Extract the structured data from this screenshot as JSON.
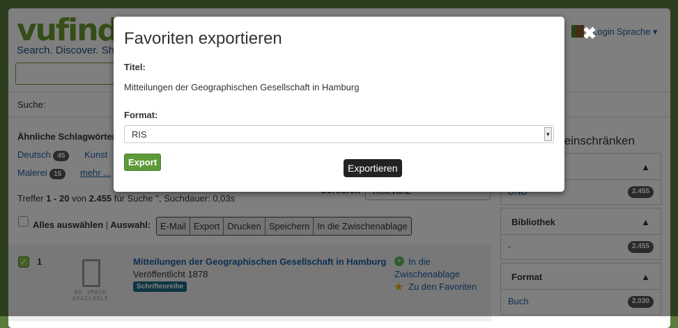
{
  "header": {
    "logo": "vufind",
    "tagline": "Search. Discover. Share.",
    "login": "Login",
    "language": "Sprache"
  },
  "search": {
    "label": "Suche:"
  },
  "similar": {
    "heading": "Ähnliche Schlagwörter",
    "tags": [
      {
        "label": "Deutsch",
        "count": "45"
      },
      {
        "label": "Kunst",
        "count": ""
      },
      {
        "label": "Malerei",
        "count": "15"
      }
    ],
    "more": "mehr ..."
  },
  "results": {
    "prefix": "Treffer ",
    "range": "1 - 20",
    "von": " von ",
    "total": "2.455",
    "suffix": " für Suche '', Suchdauer: 0,03s",
    "sort_label": "Sortieren",
    "sort_value": "Relevanz",
    "select_all": "Alles auswählen",
    "sep": "|",
    "selection": "Auswahl:",
    "actions": [
      "E-Mail",
      "Export",
      "Drucken",
      "Speichern",
      "In die Zwischenablage"
    ]
  },
  "record": {
    "number": "1",
    "no_image": "NO IMAGE AVAILABLE",
    "title": "Mitteilungen der Geographischen Gesellschaft in Hamburg",
    "published": "Veröffentlicht 1878",
    "format": "Schriftenreihe",
    "clipboard": "In die Zwischenablage",
    "favorites": "Zu den Favoriten"
  },
  "sidebar": {
    "heading": "Ergebnisse einschränken",
    "facets": [
      {
        "title": "",
        "items": [
          {
            "label": "DNB",
            "count": "2.455"
          }
        ]
      },
      {
        "title": "Bibliothek",
        "items": [
          {
            "label": "-",
            "count": "2.455"
          }
        ]
      },
      {
        "title": "Format",
        "items": [
          {
            "label": "Buch",
            "count": "2.030"
          }
        ]
      }
    ]
  },
  "modal": {
    "title": "Favoriten exportieren",
    "title_label": "Titel:",
    "title_value": "Mitteilungen der Geographischen Gesellschaft in Hamburg",
    "format_label": "Format:",
    "format_value": "RIS",
    "export_button": "Export",
    "tooltip": "Exportieren",
    "close": "✖"
  }
}
